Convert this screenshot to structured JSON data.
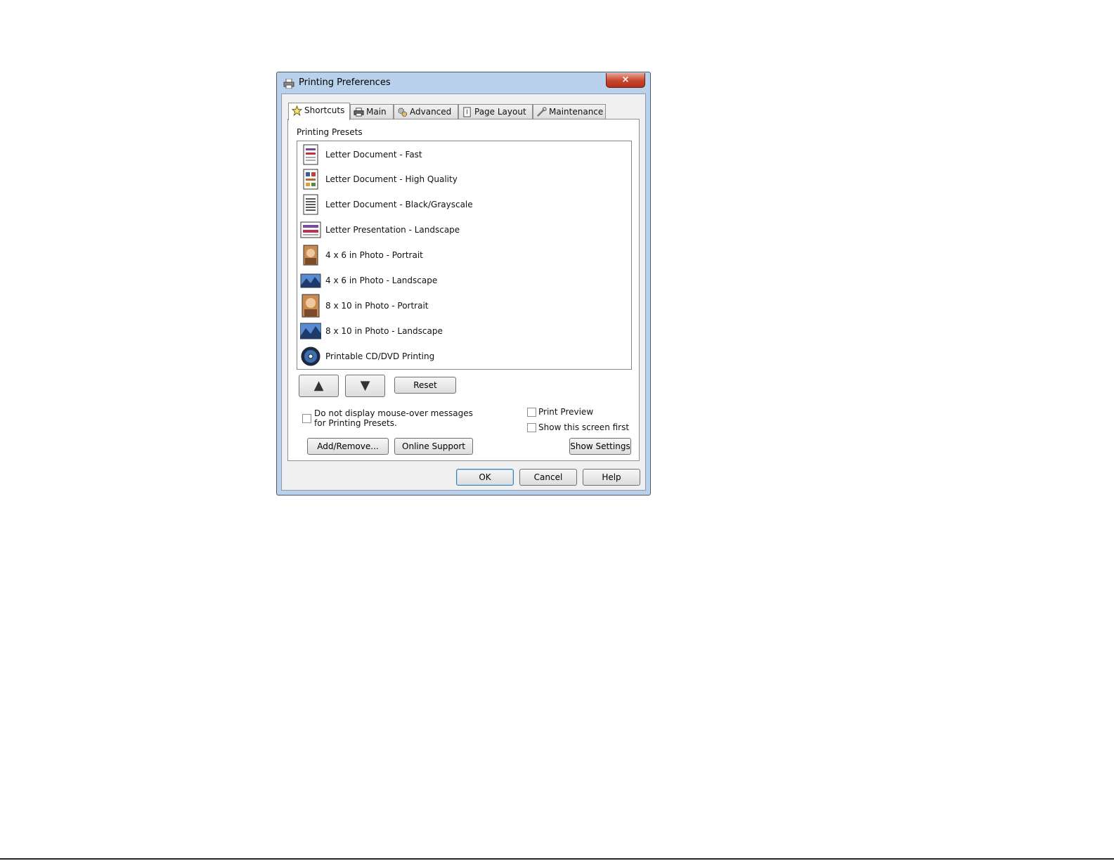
{
  "window": {
    "title": "Printing Preferences",
    "close_glyph": "×"
  },
  "tabs": [
    {
      "label": "Shortcuts",
      "icon": "star-icon",
      "active": true
    },
    {
      "label": "Main",
      "icon": "printer-icon",
      "active": false
    },
    {
      "label": "Advanced",
      "icon": "gears-icon",
      "active": false
    },
    {
      "label": "Page Layout",
      "icon": "page-icon",
      "active": false
    },
    {
      "label": "Maintenance",
      "icon": "wrench-icon",
      "active": false
    }
  ],
  "presets": {
    "section_label": "Printing Presets",
    "items": [
      {
        "label": "Letter Document - Fast",
        "icon": "document-fast-icon"
      },
      {
        "label": "Letter Document - High Quality",
        "icon": "document-high-quality-icon"
      },
      {
        "label": "Letter Document - Black/Grayscale",
        "icon": "document-grayscale-icon"
      },
      {
        "label": "Letter Presentation - Landscape",
        "icon": "presentation-landscape-icon"
      },
      {
        "label": "4 x 6 in Photo - Portrait",
        "icon": "photo-portrait-icon"
      },
      {
        "label": "4 x 6 in Photo - Landscape",
        "icon": "photo-landscape-icon"
      },
      {
        "label": "8 x 10 in Photo - Portrait",
        "icon": "photo-portrait-icon"
      },
      {
        "label": "8 x 10 in Photo - Landscape",
        "icon": "photo-landscape-icon"
      },
      {
        "label": "Printable CD/DVD Printing",
        "icon": "cd-dvd-icon"
      }
    ]
  },
  "controls": {
    "up_glyph": "▲",
    "down_glyph": "▼",
    "reset_label": "Reset",
    "mouseover_line1": "Do not display mouse-over messages",
    "mouseover_line2": "for Printing Presets.",
    "print_preview_label": "Print Preview",
    "show_screen_first_label": "Show this screen first",
    "add_remove_label": "Add/Remove...",
    "online_support_label": "Online Support",
    "show_settings_label": "Show Settings"
  },
  "footer": {
    "ok_label": "OK",
    "cancel_label": "Cancel",
    "help_label": "Help"
  }
}
